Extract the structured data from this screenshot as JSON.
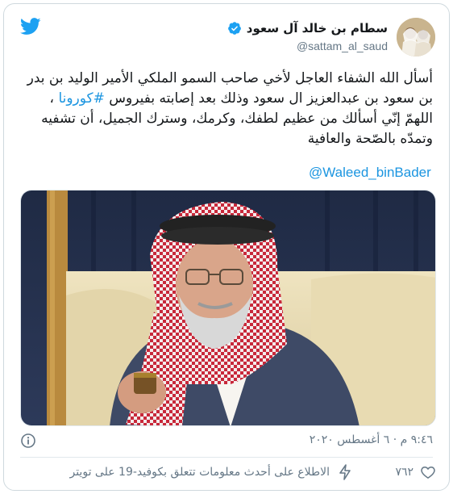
{
  "author": {
    "display_name": "سطام بن خالد آل سعود",
    "handle": "@sattam_al_saud",
    "verified": true
  },
  "tweet": {
    "text_main": "أسأل الله الشفاء العاجل لأخي صاحب السمو الملكي الأمير الوليد بن بدر بن سعود بن عبدالعزيز ال سعود وذلك بعد إصابته بفيروس ",
    "hashtag": "#كورونا",
    "text_rest": " ، اللهمّ إنّي أسألك من عظيم لطفك، وكرمك، وسترك الجميل، أن تشفيه وتمدّه بالصّحة والعافية",
    "mention": "@Waleed_binBader"
  },
  "footer": {
    "timestamp": "٩:٤٦ م · ٦ أغسطس ٢٠٢٠",
    "like_count": "٧٦٢",
    "info_link": "الاطلاع على أحدث معلومات تتعلق بكوفيد-19 على تويتر"
  },
  "colors": {
    "brand_blue": "#1da1f2",
    "link_blue": "#1b95e0",
    "muted_gray": "#657786"
  },
  "icons": {
    "brand": "twitter-bird-icon",
    "verified": "verified-badge-icon",
    "info": "info-icon",
    "like": "heart-icon",
    "covid": "lightning-bolt-icon"
  }
}
